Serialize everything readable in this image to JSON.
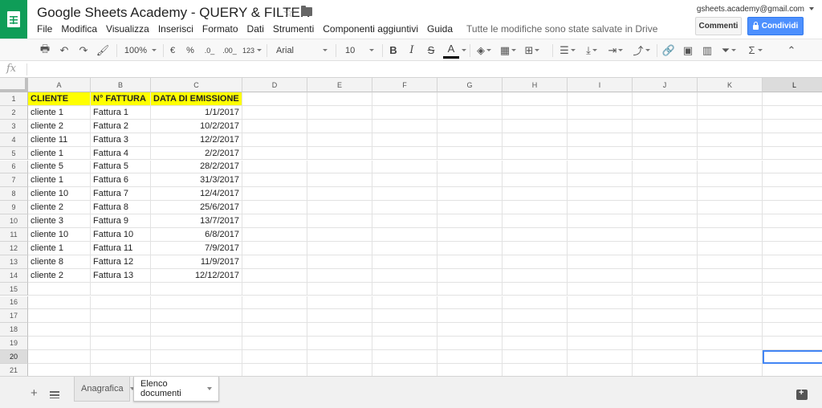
{
  "doc": {
    "title": "Google Sheets Academy - QUERY & FILTER",
    "saved_status": "Tutte le modifiche sono state salvate in Drive",
    "account": "gsheets.academy@gmail.com"
  },
  "menu": [
    "File",
    "Modifica",
    "Visualizza",
    "Inserisci",
    "Formato",
    "Dati",
    "Strumenti",
    "Componenti aggiuntivi",
    "Guida"
  ],
  "buttons": {
    "comments": "Commenti",
    "share": "Condividi"
  },
  "toolbar": {
    "zoom": "100%",
    "currency": "€",
    "percent": "%",
    "dec_decrease": ".0_",
    "dec_increase": ".00_",
    "more_formats": "123",
    "font": "Arial",
    "font_size": "10",
    "bold": "B",
    "italic": "I",
    "strike": "S",
    "text_color": "A",
    "sum": "Σ"
  },
  "formula_bar": {
    "fx": "fx"
  },
  "columns": [
    "A",
    "B",
    "C",
    "D",
    "E",
    "F",
    "G",
    "H",
    "I",
    "J",
    "K",
    "L"
  ],
  "selected_column": "L",
  "rows": [
    "1",
    "2",
    "3",
    "4",
    "5",
    "6",
    "7",
    "8",
    "9",
    "10",
    "11",
    "12",
    "13",
    "14",
    "15",
    "16",
    "17",
    "18",
    "19",
    "20",
    "21"
  ],
  "selected_row": "20",
  "header_row": [
    "CLIENTE",
    "N° FATTURA",
    "DATA DI EMISSIONE"
  ],
  "table": [
    [
      "cliente 1",
      "Fattura 1",
      "1/1/2017"
    ],
    [
      "cliente 2",
      "Fattura 2",
      "10/2/2017"
    ],
    [
      "cliente 11",
      "Fattura 3",
      "12/2/2017"
    ],
    [
      "cliente 1",
      "Fattura 4",
      "2/2/2017"
    ],
    [
      "cliente 5",
      "Fattura 5",
      "28/2/2017"
    ],
    [
      "cliente 1",
      "Fattura 6",
      "31/3/2017"
    ],
    [
      "cliente 10",
      "Fattura 7",
      "12/4/2017"
    ],
    [
      "cliente 2",
      "Fattura 8",
      "25/6/2017"
    ],
    [
      "cliente 3",
      "Fattura 9",
      "13/7/2017"
    ],
    [
      "cliente 10",
      "Fattura 10",
      "6/8/2017"
    ],
    [
      "cliente 1",
      "Fattura 11",
      "7/9/2017"
    ],
    [
      "cliente 8",
      "Fattura 12",
      "11/9/2017"
    ],
    [
      "cliente 2",
      "Fattura 13",
      "12/12/2017"
    ]
  ],
  "sheets": [
    {
      "label": "Anagrafica",
      "active": false
    },
    {
      "label": "Elenco documenti",
      "active": true
    }
  ],
  "colors": {
    "header_fill": "#ffff00",
    "brand": "#0f9d58",
    "share": "#4d90fe",
    "selection": "#4285f4"
  }
}
